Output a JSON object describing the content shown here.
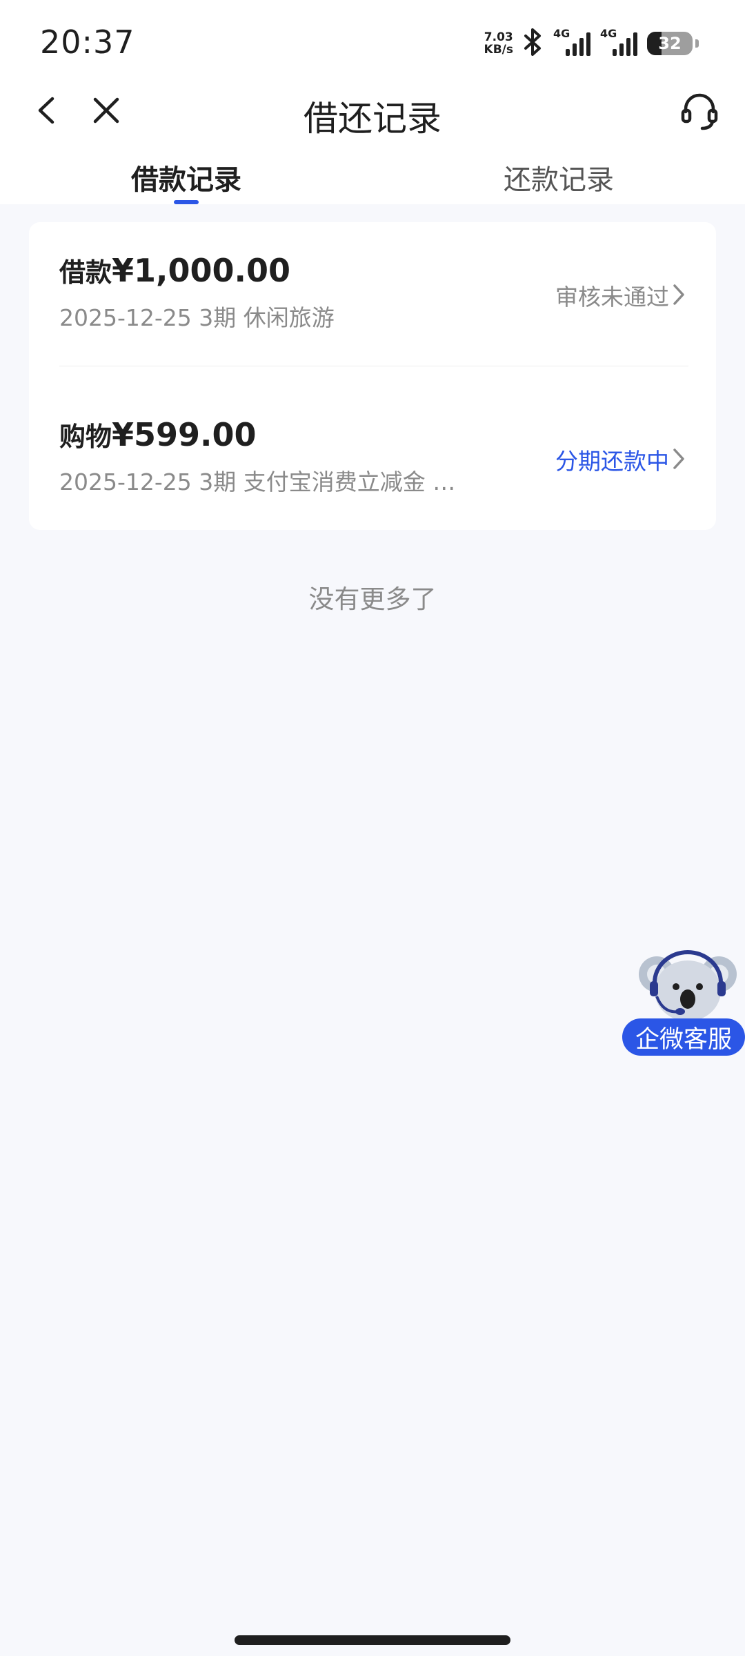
{
  "status_bar": {
    "time": "20:37",
    "net_speed_value": "7.03",
    "net_speed_unit": "KB/s",
    "signal1_label": "4G",
    "signal2_label": "4G",
    "battery_level": "32"
  },
  "nav": {
    "title": "借还记录"
  },
  "tabs": [
    {
      "label": "借款记录",
      "active": true
    },
    {
      "label": "还款记录",
      "active": false
    }
  ],
  "records": [
    {
      "category": "借款",
      "amount": "¥1,000.00",
      "detail": "2025-12-25 3期  休闲旅游",
      "status": "审核未通过",
      "status_color": "#8a8a8a"
    },
    {
      "category": "购物",
      "amount": "¥599.00",
      "detail": "2025-12-25 3期  支付宝消费立减金 …",
      "status": "分期还款中",
      "status_color": "#2b56e6"
    }
  ],
  "list_footer": "没有更多了",
  "floating_service": {
    "label": "企微客服"
  },
  "colors": {
    "accent": "#2b56e6",
    "background": "#f7f8fc"
  }
}
